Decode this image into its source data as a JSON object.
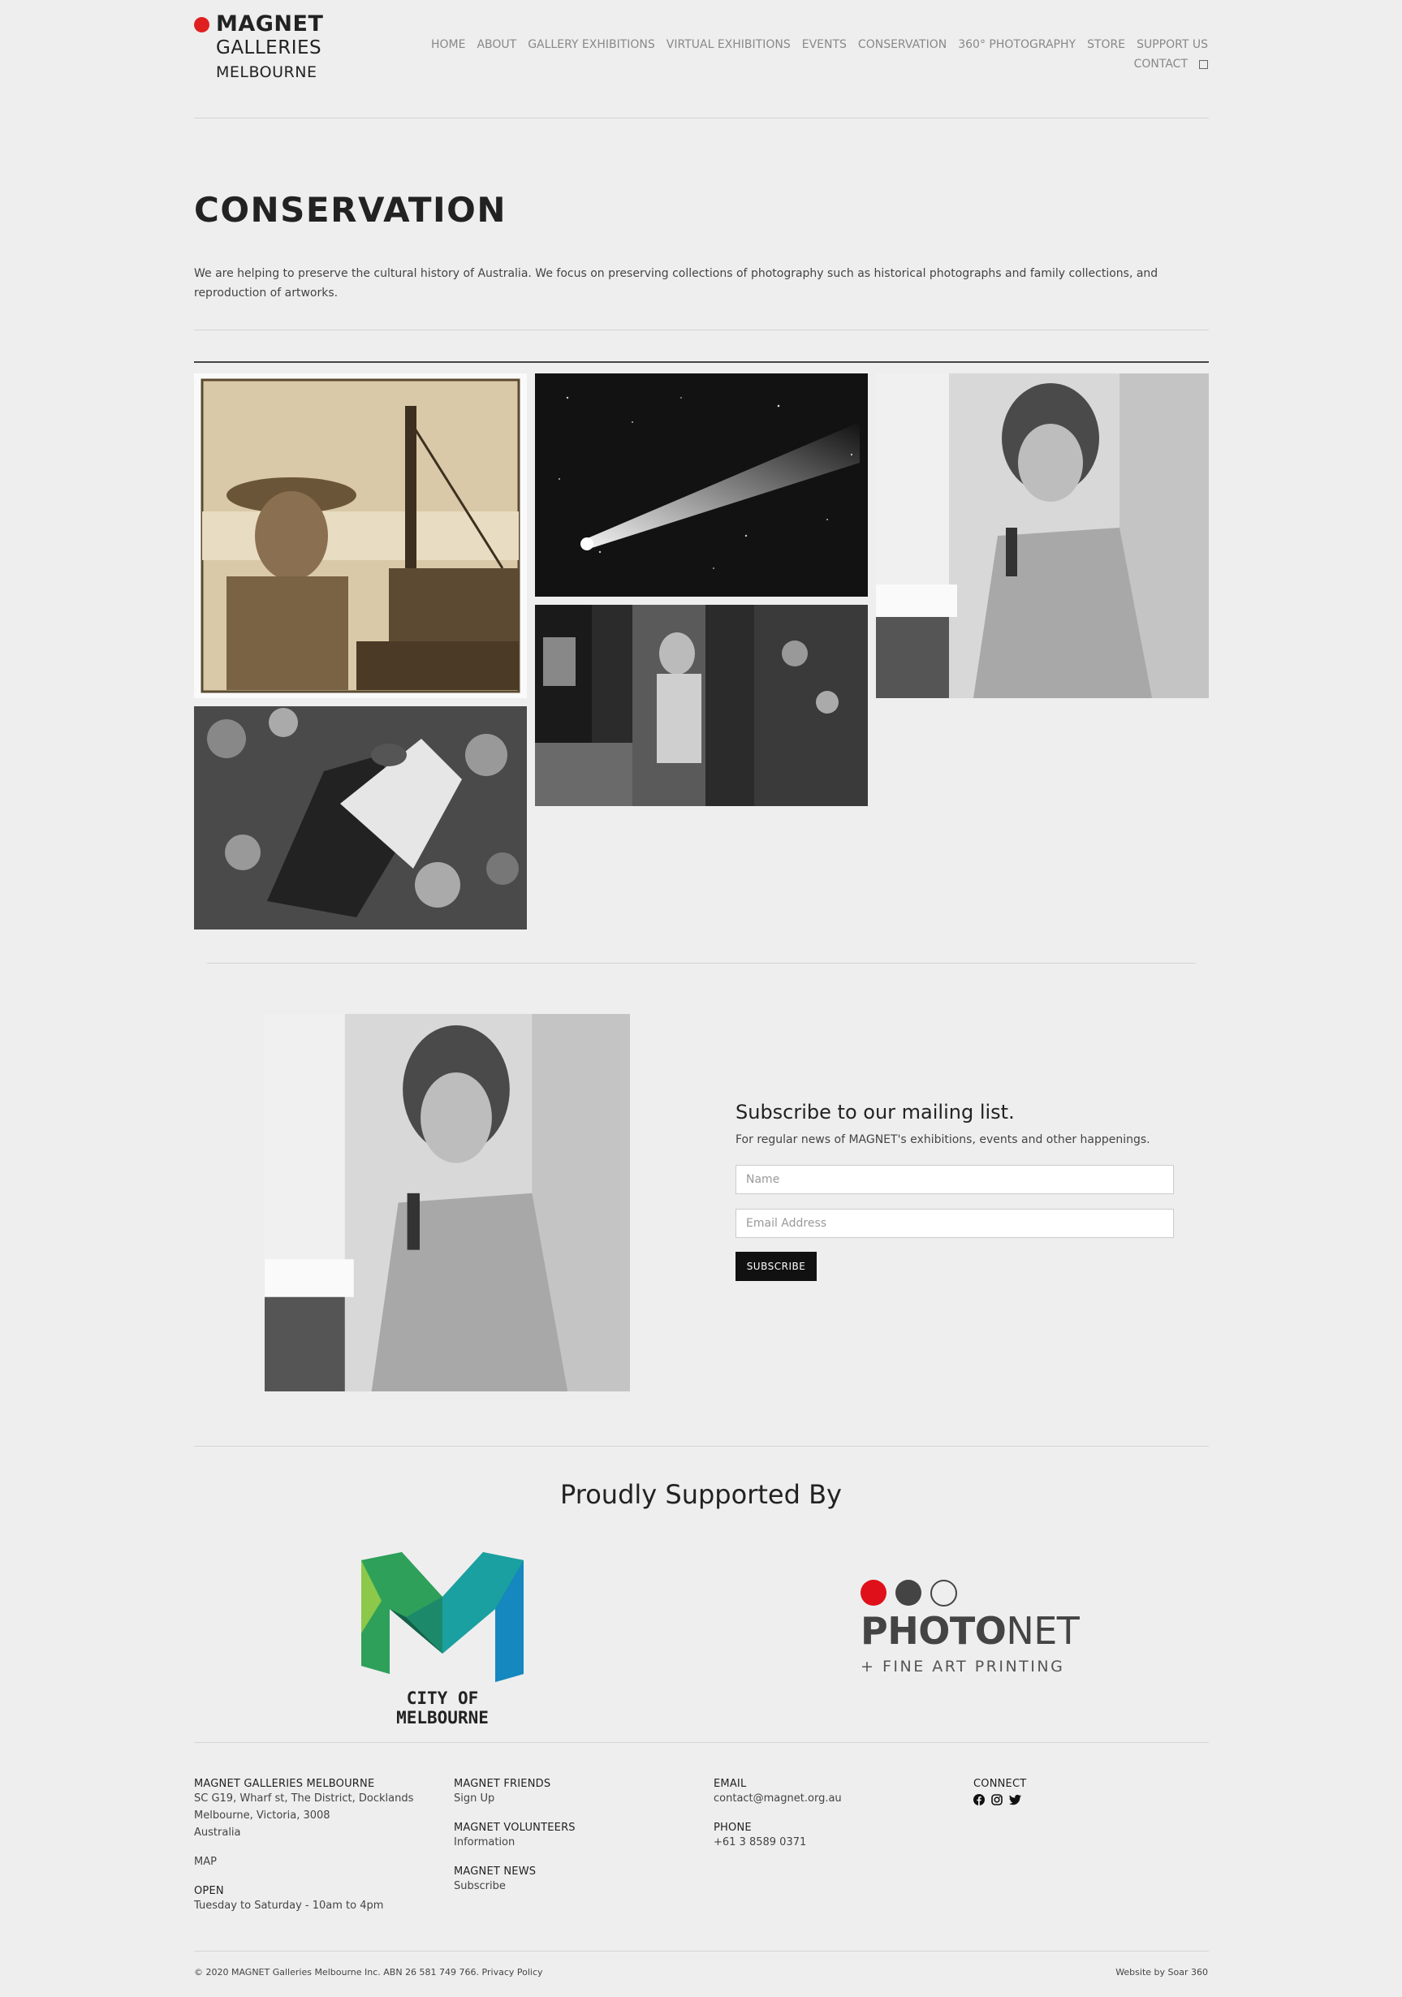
{
  "logo": {
    "line1": "MAGNET",
    "line2": "GALLERIES",
    "line3": "MELBOURNE"
  },
  "nav": {
    "items": [
      "HOME",
      "ABOUT",
      "GALLERY EXHIBITIONS",
      "VIRTUAL EXHIBITIONS",
      "EVENTS",
      "CONSERVATION",
      "360° PHOTOGRAPHY",
      "STORE",
      "SUPPORT US"
    ],
    "contact": "CONTACT"
  },
  "page": {
    "title": "CONSERVATION",
    "intro": "We are helping to preserve the cultural history of Australia. We focus on preserving collections of photography such as historical photographs and family collections, and reproduction of artworks."
  },
  "subscribe": {
    "heading": "Subscribe to our mailing list.",
    "text": "For regular news of MAGNET's exhibitions, events and other happenings.",
    "name_placeholder": "Name",
    "email_placeholder": "Email Address",
    "button": "SUBSCRIBE"
  },
  "supported": {
    "heading": "Proudly Supported By",
    "city_label": "CITY OF MELBOURNE",
    "photonet_bold": "PHOTO",
    "photonet_light": "NET",
    "photonet_tag": "+ FINE ART PRINTING"
  },
  "footer": {
    "col1": {
      "title": "MAGNET GALLERIES MELBOURNE",
      "addr1": "SC G19, Wharf st, The District, Docklands",
      "addr2": "Melbourne, Victoria, 3008",
      "addr3": "Australia",
      "map": "MAP",
      "open_title": "OPEN",
      "open_text": "Tuesday to Saturday - 10am to 4pm"
    },
    "col2": {
      "friends_title": "MAGNET FRIENDS",
      "friends_link": "Sign Up",
      "volunteers_title": "MAGNET VOLUNTEERS",
      "volunteers_link": "Information",
      "news_title": "MAGNET NEWS",
      "news_link": "Subscribe"
    },
    "col3": {
      "email_title": "EMAIL",
      "email": "contact@magnet.org.au",
      "phone_title": "PHONE",
      "phone": "+61 3 8589 0371"
    },
    "col4": {
      "connect_title": "CONNECT"
    },
    "copyright": "© 2020 MAGNET Galleries Melbourne Inc. ABN 26 581 749 766.",
    "privacy": "Privacy Policy",
    "credit_prefix": "Website by",
    "credit_link": "Soar 360"
  },
  "icons": [
    "facebook-icon",
    "instagram-icon",
    "twitter-icon"
  ],
  "colors": {
    "brand_red": "#e02020",
    "text_dark": "#222222",
    "background": "#eeeeee"
  }
}
